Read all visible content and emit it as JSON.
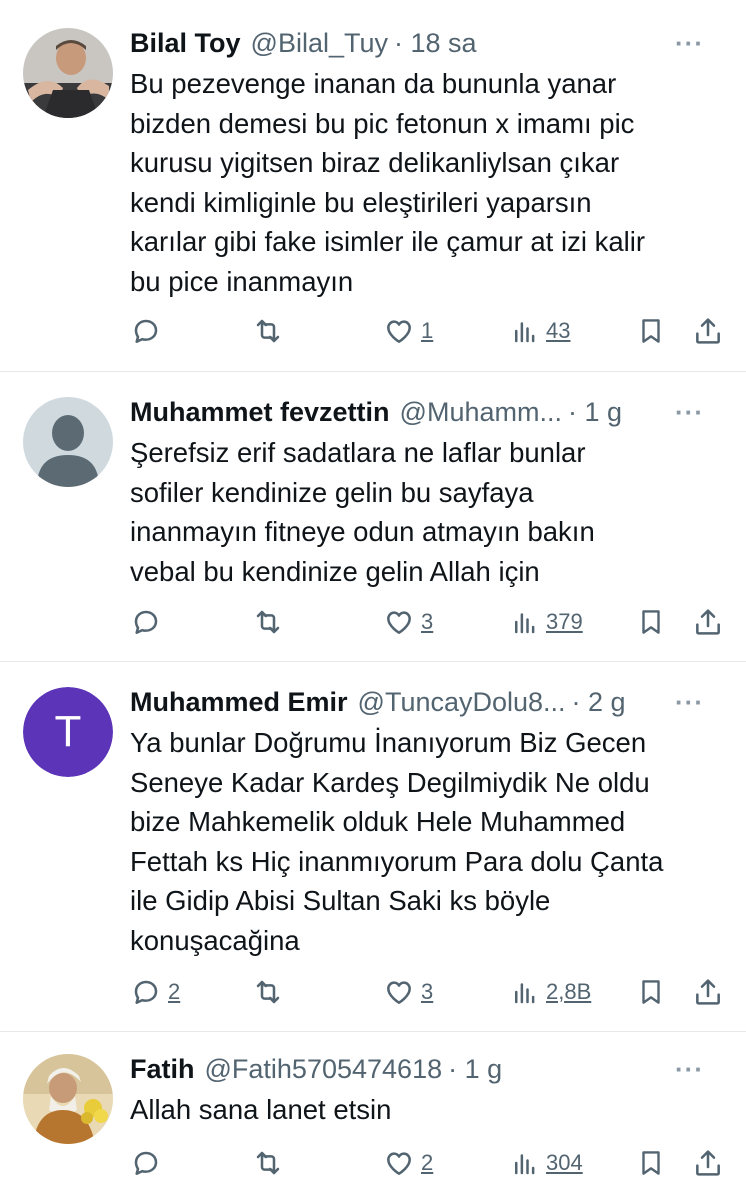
{
  "tweets": [
    {
      "name": "Bilal Toy",
      "handle": "@Bilal_Tuy",
      "time": "· 18 sa",
      "more": "···",
      "text": "Bu pezevenge inanan da bununla yanar\nbizden demesi bu pic fetonun x imamı pic\nkurusu yigitsen biraz delikanliylsan çıkar\nkendi kimliginle bu eleştirileri yaparsın\nkarılar gibi fake isimler ile çamur at izi kalir\nbu pice inanmayın",
      "reply_count": "",
      "retweet_count": "",
      "like_count": "1",
      "view_count": "43"
    },
    {
      "name": "Muhammet fevzettin",
      "handle": "@Muhamm...",
      "time": "· 1 g",
      "more": "···",
      "text": "Şerefsiz erif sadatlara ne laflar bunlar\nsofiler kendinize gelin bu sayfaya\ninanmayın fitneye odun atmayın bakın\nvebal bu kendinize gelin Allah için",
      "reply_count": "",
      "retweet_count": "",
      "like_count": "3",
      "view_count": "379"
    },
    {
      "name": "Muhammed Emir",
      "handle": "@TuncayDolu8...",
      "time": "· 2 g",
      "more": "···",
      "avatar_initial": "T",
      "text": "Ya bunlar Doğrumu İnanıyorum Biz Gecen\nSeneye Kadar Kardeş Degilmiydik Ne oldu\nbize Mahkemelik olduk Hele Muhammed\nFettah ks Hiç inanmıyorum Para dolu Çanta\nile Gidip Abisi Sultan Saki ks böyle\nkonuşacağina",
      "reply_count": "2",
      "retweet_count": "",
      "like_count": "3",
      "view_count": "2,8B"
    },
    {
      "name": "Fatih",
      "handle": "@Fatih5705474618",
      "time": "· 1 g",
      "more": "···",
      "text": "Allah sana lanet etsin",
      "reply_count": "",
      "retweet_count": "",
      "like_count": "2",
      "view_count": "304"
    }
  ],
  "colors": {
    "text": "#0f1419",
    "secondary": "#536471",
    "divider": "#e6e9ec",
    "avatar_t_bg": "#5b34b8"
  }
}
